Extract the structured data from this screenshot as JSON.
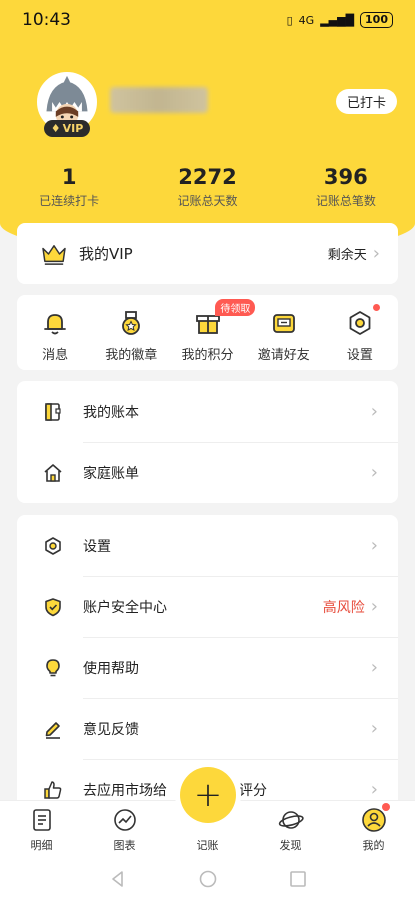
{
  "status_bar": {
    "time": "10:43",
    "network": "4G",
    "battery": "100"
  },
  "profile": {
    "vip_badge": "VIP",
    "checkin_button": "已打卡"
  },
  "stats": [
    {
      "value": "1",
      "label": "已连续打卡"
    },
    {
      "value": "2272",
      "label": "记账总天数"
    },
    {
      "value": "396",
      "label": "记账总笔数"
    }
  ],
  "vip_card": {
    "title": "我的VIP",
    "right_text": "剩余天"
  },
  "quick_actions": [
    {
      "label": "消息",
      "icon": "bell-icon"
    },
    {
      "label": "我的徽章",
      "icon": "medal-icon"
    },
    {
      "label": "我的积分",
      "icon": "gift-icon",
      "tag": "待领取"
    },
    {
      "label": "邀请好友",
      "icon": "invite-icon"
    },
    {
      "label": "设置",
      "icon": "hex-settings-icon"
    }
  ],
  "list_group_1": [
    {
      "label": "我的账本",
      "icon": "ledger-icon"
    },
    {
      "label": "家庭账单",
      "icon": "home-icon"
    }
  ],
  "list_group_2": [
    {
      "label": "设置",
      "icon": "settings-icon"
    },
    {
      "label": "账户安全中心",
      "icon": "shield-icon",
      "status": "高风险"
    },
    {
      "label": "使用帮助",
      "icon": "bulb-icon"
    },
    {
      "label": "意见反馈",
      "icon": "pencil-icon"
    },
    {
      "label": "去应用市场给",
      "label_tail": "评分",
      "icon": "thumbs-up-icon"
    }
  ],
  "tabs": [
    {
      "label": "明细"
    },
    {
      "label": "图表"
    },
    {
      "label": "记账"
    },
    {
      "label": "发现"
    },
    {
      "label": "我的"
    }
  ],
  "colors": {
    "accent": "#fdd83b",
    "risk": "#e74c3c",
    "dot": "#ff5a52"
  }
}
